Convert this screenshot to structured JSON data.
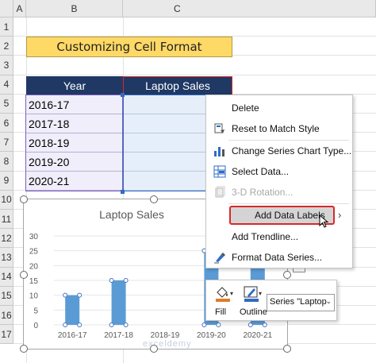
{
  "columns": [
    "A",
    "B",
    "C"
  ],
  "rows": [
    "1",
    "2",
    "3",
    "4",
    "5",
    "6",
    "7",
    "8",
    "9",
    "10",
    "11",
    "12",
    "13",
    "14",
    "15",
    "16",
    "17"
  ],
  "sheet_title": "Customizing Cell Format",
  "table": {
    "header_year": "Year",
    "header_sales": "Laptop Sales",
    "years": [
      "2016-17",
      "2017-18",
      "2018-19",
      "2019-20",
      "2020-21"
    ]
  },
  "chart_data": {
    "type": "bar",
    "title": "Laptop Sales",
    "categories": [
      "2016-17",
      "2017-18",
      "2018-19",
      "2019-20",
      "2020-21"
    ],
    "values": [
      10,
      15,
      0,
      25,
      20
    ],
    "y_ticks": [
      "0",
      "5",
      "10",
      "15",
      "20",
      "25",
      "30"
    ],
    "ylim": [
      0,
      30
    ],
    "bar_color": "#5b9bd5"
  },
  "context_menu": {
    "items": [
      {
        "label": "Delete",
        "icon": "none",
        "disabled": false
      },
      {
        "label": "Reset to Match Style",
        "icon": "reset-style-icon",
        "disabled": false
      },
      {
        "label": "Change Series Chart Type...",
        "icon": "chart-type-icon",
        "disabled": false
      },
      {
        "label": "Select Data...",
        "icon": "select-data-icon",
        "disabled": false
      },
      {
        "label": "3-D Rotation...",
        "icon": "rotation-3d-icon",
        "disabled": true
      },
      {
        "label": "Add Data Labels",
        "icon": "none",
        "disabled": false,
        "highlighted": true,
        "submenu": true
      },
      {
        "label": "Add Trendline...",
        "icon": "none",
        "disabled": false
      },
      {
        "label": "Format Data Series...",
        "icon": "format-series-icon",
        "disabled": false
      }
    ]
  },
  "mini_toolbar": {
    "fill_label": "Fill",
    "outline_label": "Outline",
    "series_select": "Series \"Laptop"
  },
  "watermark": "exceldemy",
  "colors": {
    "title_fill": "#ffd966",
    "header_fill": "#1f3864",
    "highlight_border": "#d62a2a",
    "highlight_fill": "#d4d4d4"
  }
}
